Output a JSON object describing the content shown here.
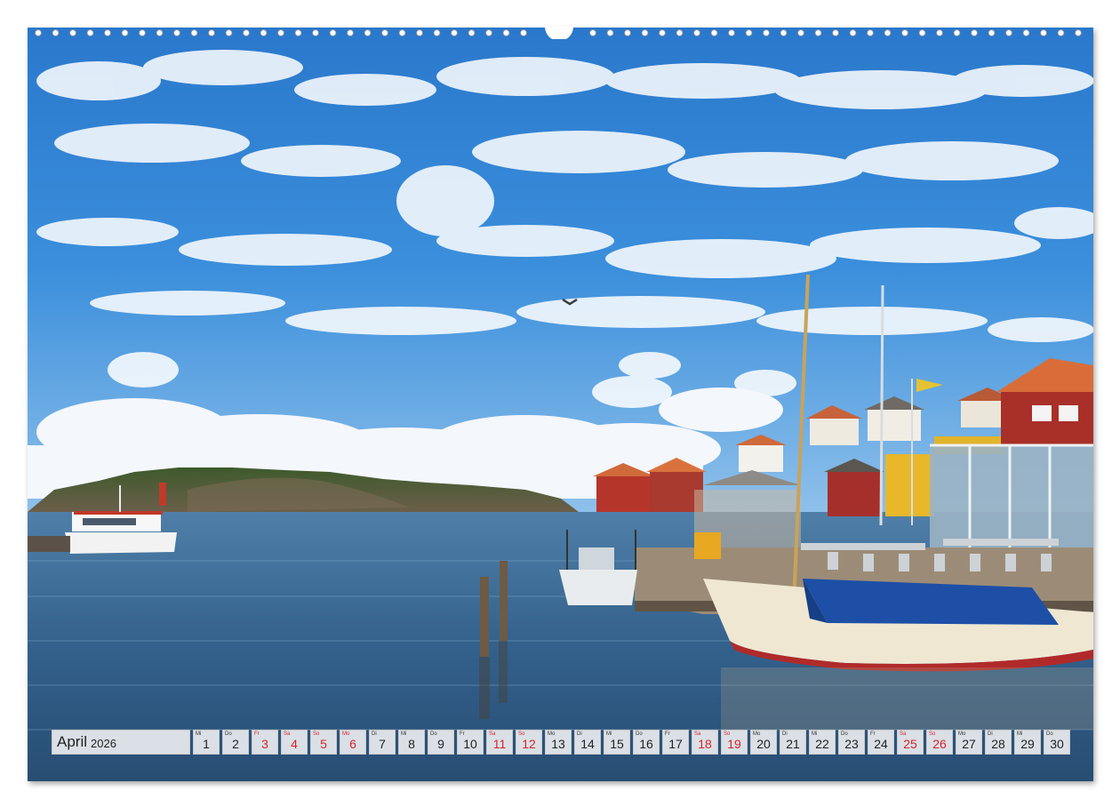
{
  "calendar": {
    "month": "April",
    "year": "2026",
    "days": [
      {
        "wd": "Mi",
        "n": "1",
        "h": false
      },
      {
        "wd": "Do",
        "n": "2",
        "h": false
      },
      {
        "wd": "Fr",
        "n": "3",
        "h": true
      },
      {
        "wd": "Sa",
        "n": "4",
        "h": true
      },
      {
        "wd": "So",
        "n": "5",
        "h": true
      },
      {
        "wd": "Mo",
        "n": "6",
        "h": true
      },
      {
        "wd": "Di",
        "n": "7",
        "h": false
      },
      {
        "wd": "Mi",
        "n": "8",
        "h": false
      },
      {
        "wd": "Do",
        "n": "9",
        "h": false
      },
      {
        "wd": "Fr",
        "n": "10",
        "h": false
      },
      {
        "wd": "Sa",
        "n": "11",
        "h": true
      },
      {
        "wd": "So",
        "n": "12",
        "h": true
      },
      {
        "wd": "Mo",
        "n": "13",
        "h": false
      },
      {
        "wd": "Di",
        "n": "14",
        "h": false
      },
      {
        "wd": "Mi",
        "n": "15",
        "h": false
      },
      {
        "wd": "Do",
        "n": "16",
        "h": false
      },
      {
        "wd": "Fr",
        "n": "17",
        "h": false
      },
      {
        "wd": "Sa",
        "n": "18",
        "h": true
      },
      {
        "wd": "So",
        "n": "19",
        "h": true
      },
      {
        "wd": "Mo",
        "n": "20",
        "h": false
      },
      {
        "wd": "Di",
        "n": "21",
        "h": false
      },
      {
        "wd": "Mi",
        "n": "22",
        "h": false
      },
      {
        "wd": "Do",
        "n": "23",
        "h": false
      },
      {
        "wd": "Fr",
        "n": "24",
        "h": false
      },
      {
        "wd": "Sa",
        "n": "25",
        "h": true
      },
      {
        "wd": "So",
        "n": "26",
        "h": true
      },
      {
        "wd": "Mo",
        "n": "27",
        "h": false
      },
      {
        "wd": "Di",
        "n": "28",
        "h": false
      },
      {
        "wd": "Mi",
        "n": "29",
        "h": false
      },
      {
        "wd": "Do",
        "n": "30",
        "h": false
      }
    ]
  },
  "colors": {
    "sky": "#2f86d6",
    "water": "#2f5c86",
    "holiday": "#d6242b"
  }
}
